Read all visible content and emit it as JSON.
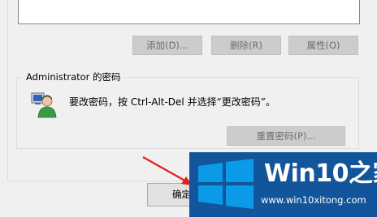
{
  "buttons": {
    "add": "添加(D)...",
    "delete": "删除(R)",
    "properties": "属性(O)",
    "reset_password": "重置密码(P)...",
    "ok": "确定"
  },
  "password_group": {
    "title": "Administrator 的密码",
    "message": "要改密码，按 Ctrl-Alt-Del 并选择“更改密码”。"
  },
  "watermark": {
    "brand_prefix": "Win10",
    "brand_suffix": "之家",
    "url": "www.win10xitong.com"
  },
  "colors": {
    "window_bg": "#f0f0f0",
    "disabled_button": "#cccccc",
    "arrow": "#e02020",
    "watermark_bg": "#13559a"
  }
}
